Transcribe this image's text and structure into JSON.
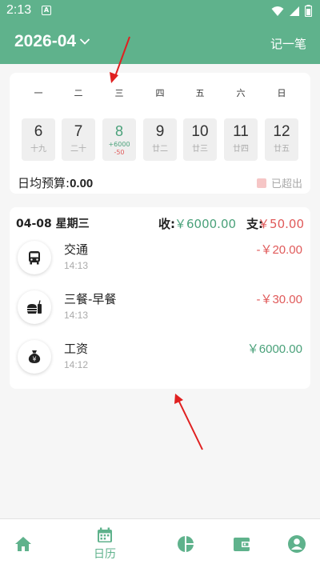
{
  "status_bar": {
    "time": "2:13",
    "notif_icon": "a-icon"
  },
  "header": {
    "month": "2026-04",
    "record_label": "记一笔"
  },
  "calendar": {
    "weekdays": [
      "一",
      "二",
      "三",
      "四",
      "五",
      "六",
      "日"
    ],
    "days": [
      {
        "num": "6",
        "lunar": "十九"
      },
      {
        "num": "7",
        "lunar": "二十"
      },
      {
        "num": "8",
        "income": "+6000",
        "expense": "-50"
      },
      {
        "num": "9",
        "lunar": "廿二"
      },
      {
        "num": "10",
        "lunar": "廿三"
      },
      {
        "num": "11",
        "lunar": "廿四"
      },
      {
        "num": "12",
        "lunar": "廿五"
      }
    ],
    "budget_label": "日均预算:",
    "budget_value": "0.00",
    "overspent_label": "已超出",
    "overspent_color": "#f6c6c6"
  },
  "day": {
    "date": "04-08 星期三",
    "income_label": "收:",
    "income_value": "￥6000.00",
    "expense_label": "支:",
    "expense_value": "￥50.00",
    "transactions": [
      {
        "name": "交通",
        "time": "14:13",
        "amount": "-￥20.00",
        "type": "expense",
        "icon": "bus-icon"
      },
      {
        "name": "三餐-早餐",
        "time": "14:13",
        "amount": "-￥30.00",
        "type": "expense",
        "icon": "meal-icon"
      },
      {
        "name": "工资",
        "time": "14:12",
        "amount": "￥6000.00",
        "type": "income",
        "icon": "money-bag-icon"
      }
    ]
  },
  "nav": {
    "items": [
      {
        "icon": "home-icon"
      },
      {
        "icon": "calendar-icon",
        "label": "日历",
        "active": true
      },
      {
        "icon": "pie-chart-icon"
      },
      {
        "icon": "wallet-icon"
      },
      {
        "icon": "profile-icon"
      }
    ]
  },
  "colors": {
    "primary": "#5fb28c",
    "income": "#4aa17a",
    "expense": "#e05a5a",
    "annotation_arrow": "#e02020"
  }
}
